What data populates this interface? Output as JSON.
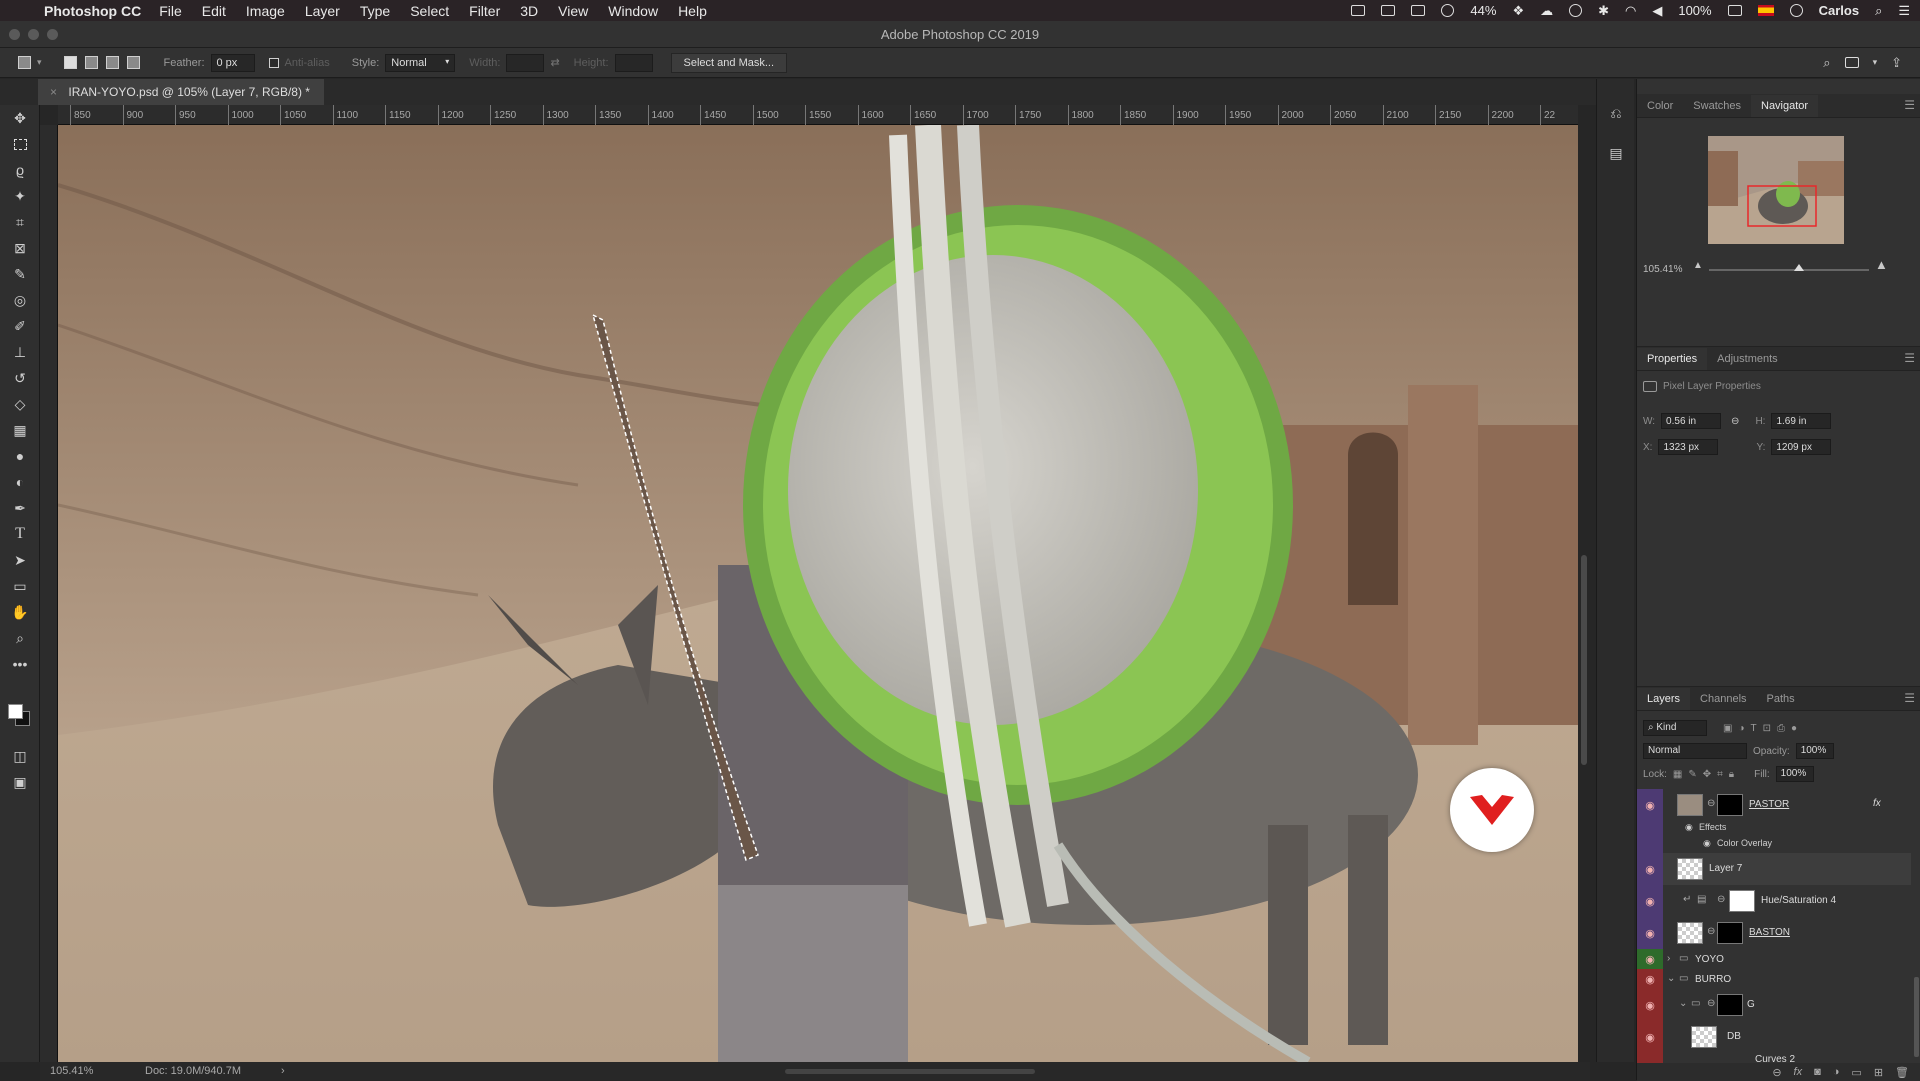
{
  "menubar": {
    "app_name": "Photoshop CC",
    "items": [
      "File",
      "Edit",
      "Image",
      "Layer",
      "Type",
      "Select",
      "Filter",
      "3D",
      "View",
      "Window",
      "Help"
    ],
    "battery_small": "44%",
    "battery": "100%",
    "user": "Carlos"
  },
  "window": {
    "title": "Adobe Photoshop CC 2019"
  },
  "options": {
    "feather_label": "Feather:",
    "feather_value": "0 px",
    "antialias_label": "Anti-alias",
    "style_label": "Style:",
    "style_value": "Normal",
    "width_label": "Width:",
    "height_label": "Height:",
    "select_mask_label": "Select and Mask..."
  },
  "document": {
    "tab_title": "IRAN-YOYO.psd @ 105% (Layer 7, RGB/8) *",
    "ruler_ticks": [
      "850",
      "900",
      "950",
      "1000",
      "1050",
      "1100",
      "1150",
      "1200",
      "1250",
      "1300",
      "1350",
      "1400",
      "1450",
      "1500",
      "1550",
      "1600",
      "1650",
      "1700",
      "1750",
      "1800",
      "1850",
      "1900",
      "1950",
      "2000",
      "2050",
      "2100",
      "2150",
      "2200",
      "22"
    ]
  },
  "status": {
    "zoom": "105.41%",
    "doc": "Doc: 19.0M/940.7M"
  },
  "navigator": {
    "tabs": [
      "Color",
      "Swatches",
      "Navigator"
    ],
    "active_tab": "Navigator",
    "zoom": "105.41%"
  },
  "properties": {
    "tabs": [
      "Properties",
      "Adjustments"
    ],
    "header": "Pixel Layer Properties",
    "w_label": "W:",
    "w_value": "0.56 in",
    "h_label": "H:",
    "h_value": "1.69 in",
    "x_label": "X:",
    "x_value": "1323 px",
    "y_label": "Y:",
    "y_value": "1209 px"
  },
  "layers": {
    "tabs": [
      "Layers",
      "Channels",
      "Paths"
    ],
    "filter_kind": "Kind",
    "blend_mode": "Normal",
    "opacity_label": "Opacity:",
    "opacity_value": "100%",
    "lock_label": "Lock:",
    "fill_label": "Fill:",
    "fill_value": "100%",
    "items": [
      {
        "name": "PASTOR"
      },
      {
        "name": "Effects"
      },
      {
        "name": "Color Overlay"
      },
      {
        "name": "Layer 7"
      },
      {
        "name": "Hue/Saturation 4"
      },
      {
        "name": "BASTON"
      },
      {
        "name": "YOYO"
      },
      {
        "name": "BURRO"
      },
      {
        "name": "G"
      },
      {
        "name": "DB"
      },
      {
        "name": "Curves 2"
      }
    ],
    "fx_label": "fx"
  }
}
